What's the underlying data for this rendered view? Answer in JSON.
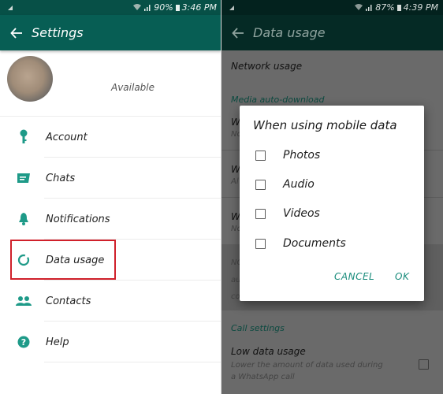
{
  "left": {
    "status_bar": {
      "battery": "90%",
      "time": "3:46 PM"
    },
    "toolbar": {
      "back_icon": "arrow-left-icon",
      "title": "Settings"
    },
    "profile": {
      "avatar": "blurred-profile-photo",
      "status": "Available"
    },
    "items": [
      {
        "label": "Account",
        "icon": "key-icon"
      },
      {
        "label": "Chats",
        "icon": "chat-icon"
      },
      {
        "label": "Notifications",
        "icon": "bell-icon"
      },
      {
        "label": "Data usage",
        "icon": "data-usage-icon",
        "highlighted": true
      },
      {
        "label": "Contacts",
        "icon": "contacts-icon"
      },
      {
        "label": "Help",
        "icon": "help-icon"
      }
    ],
    "colors": {
      "toolbar": "#075e54",
      "accent": "#1e9a88",
      "highlight": "#d0202a"
    }
  },
  "right": {
    "status_bar": {
      "battery": "87%",
      "time": "4:39 PM"
    },
    "toolbar": {
      "back_icon": "arrow-left-icon",
      "title": "Data usage"
    },
    "background": {
      "network_usage": "Network usage",
      "media_header": "Media auto-download",
      "rows_partial": [
        {
          "title": "W",
          "subtitle": "No"
        },
        {
          "title": "W",
          "subtitle": "Al"
        },
        {
          "title": "W",
          "subtitle": "No"
        }
      ],
      "note_partial": [
        "NO",
        "au",
        "co"
      ],
      "call_header": "Call settings",
      "low_data": {
        "title": "Low data usage",
        "subtitle_line1": "Lower the amount of data used during",
        "subtitle_line2": "a WhatsApp call",
        "checked": false
      }
    },
    "dialog": {
      "title": "When using mobile data",
      "options": [
        {
          "label": "Photos",
          "checked": false
        },
        {
          "label": "Audio",
          "checked": false
        },
        {
          "label": "Videos",
          "checked": false
        },
        {
          "label": "Documents",
          "checked": false
        }
      ],
      "cancel_label": "CANCEL",
      "ok_label": "OK"
    },
    "colors": {
      "button_text": "#1a8c7c",
      "scrim": "#6a6a6a"
    }
  }
}
